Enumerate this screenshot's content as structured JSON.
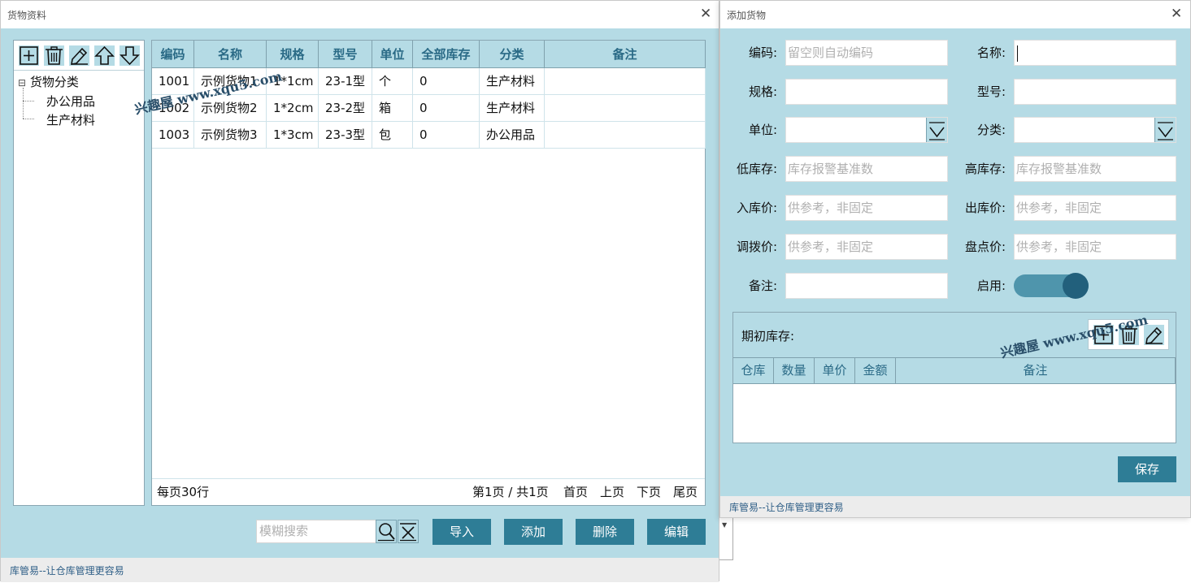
{
  "left_window": {
    "title": "货物资料",
    "close": "✕",
    "toolbar_icons": [
      "add-icon",
      "trash-icon",
      "edit-icon",
      "arrow-up-icon",
      "arrow-down-icon"
    ],
    "tree": {
      "expander": "⊟",
      "root": "货物分类",
      "children": [
        "办公用品",
        "生产材料"
      ]
    },
    "grid": {
      "columns": [
        "编码",
        "名称",
        "规格",
        "型号",
        "单位",
        "全部库存",
        "分类",
        "备注"
      ],
      "rows": [
        [
          "1001",
          "示例货物1",
          "1*1cm",
          "23-1型",
          "个",
          "0",
          "生产材料",
          ""
        ],
        [
          "1002",
          "示例货物2",
          "1*2cm",
          "23-2型",
          "箱",
          "0",
          "生产材料",
          ""
        ],
        [
          "1003",
          "示例货物3",
          "1*3cm",
          "23-3型",
          "包",
          "0",
          "办公用品",
          ""
        ]
      ]
    },
    "pager": {
      "per_page": "每页30行",
      "page_info": "第1页 / 共1页",
      "first": "首页",
      "prev": "上页",
      "next": "下页",
      "last": "尾页"
    },
    "search": {
      "placeholder": "模糊搜索",
      "search_icon": "search-icon",
      "clear_icon": "clear-filter-icon"
    },
    "actions": {
      "import": "导入",
      "add": "添加",
      "delete": "删除",
      "edit": "编辑"
    },
    "footer": "库管易--让仓库管理更容易"
  },
  "dialog": {
    "title": "添加货物",
    "close": "✕",
    "fields": {
      "code_label": "编码:",
      "code_placeholder": "留空则自动编码",
      "name_label": "名称:",
      "name_value": "",
      "spec_label": "规格:",
      "model_label": "型号:",
      "unit_label": "单位:",
      "category_label": "分类:",
      "low_stock_label": "低库存:",
      "low_stock_placeholder": "库存报警基准数",
      "high_stock_label": "高库存:",
      "high_stock_placeholder": "库存报警基准数",
      "in_price_label": "入库价:",
      "in_price_placeholder": "供参考，非固定",
      "out_price_label": "出库价:",
      "out_price_placeholder": "供参考，非固定",
      "transfer_price_label": "调拨价:",
      "transfer_price_placeholder": "供参考，非固定",
      "check_price_label": "盘点价:",
      "check_price_placeholder": "供参考，非固定",
      "remark_label": "备注:",
      "enabled_label": "启用:",
      "enabled": true
    },
    "opening_stock": {
      "title": "期初库存:",
      "toolbar_icons": [
        "add-icon",
        "trash-icon",
        "edit-icon"
      ],
      "columns": [
        "仓库",
        "数量",
        "单价",
        "金额",
        "备注"
      ]
    },
    "save": "保存",
    "footer": "库管易--让仓库管理更容易"
  },
  "watermarks": [
    "兴趣屋 www.xqu5.com",
    "兴趣屋 www.xqu5.com"
  ],
  "colors": {
    "panel_bg": "#b5dbe5",
    "button": "#2e7d96",
    "header_text": "#2a6a86",
    "toggle_track": "#4f95ac",
    "toggle_knob": "#22607c"
  }
}
